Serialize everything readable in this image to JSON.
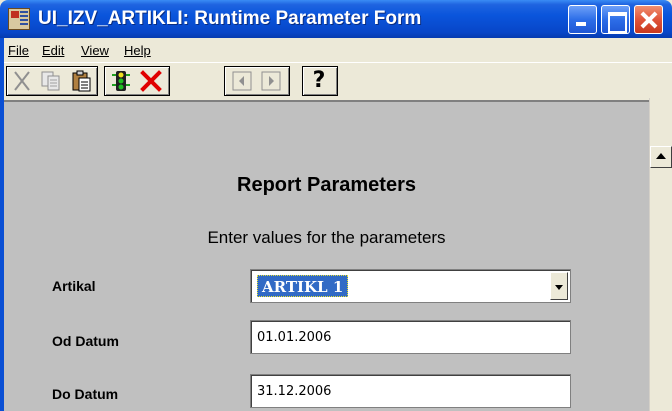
{
  "window": {
    "title": "UI_IZV_ARTIKLI: Runtime Parameter Form"
  },
  "menu": {
    "items": [
      {
        "label": "File"
      },
      {
        "label": "Edit"
      },
      {
        "label": "View"
      },
      {
        "label": "Help"
      }
    ]
  },
  "toolbar": {
    "icons": [
      "cut-icon",
      "copy-icon",
      "paste-icon",
      "run-report-icon",
      "cancel-icon",
      "previous-page-icon",
      "next-page-icon",
      "help-icon"
    ],
    "help_glyph": "?"
  },
  "form": {
    "title": "Report Parameters",
    "subtitle": "Enter values for the parameters",
    "fields": [
      {
        "label": "Artikal",
        "value": "ARTIKL 1",
        "type": "dropdown"
      },
      {
        "label": "Od Datum",
        "value": "01.01.2006",
        "type": "text"
      },
      {
        "label": "Do Datum",
        "value": "31.12.2006",
        "type": "text"
      }
    ]
  },
  "colors": {
    "titlebar": "#0a55dc",
    "form_bg": "#c0c0c0",
    "selection": "#316ac5",
    "cancel_red": "#e00000"
  }
}
